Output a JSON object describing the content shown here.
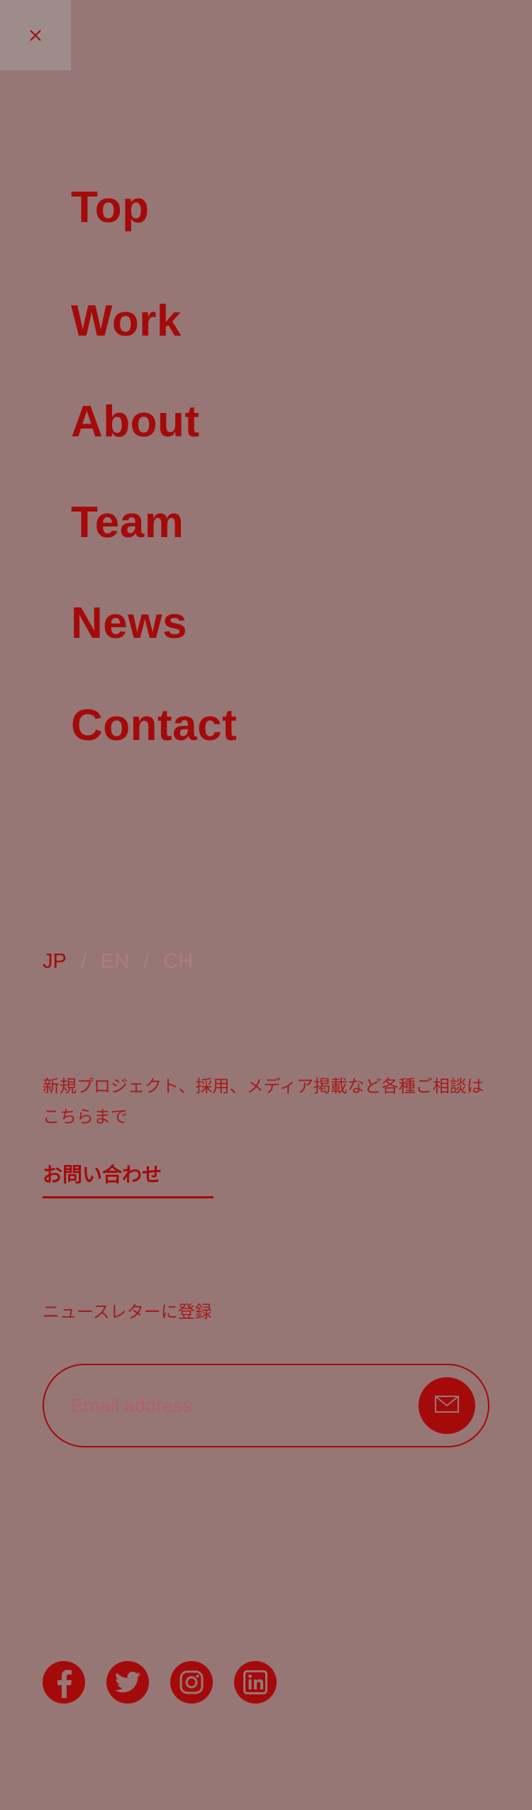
{
  "close": {
    "icon": "close-icon"
  },
  "nav": {
    "items": [
      {
        "label": "Top"
      },
      {
        "label": "Work"
      },
      {
        "label": "About"
      },
      {
        "label": "Team"
      },
      {
        "label": "News"
      },
      {
        "label": "Contact"
      }
    ]
  },
  "language": {
    "options": [
      "JP",
      "EN",
      "CH"
    ],
    "separator": "/",
    "active": "JP"
  },
  "contact": {
    "description": "新規プロジェクト、採用、メディア掲載など各種ご相談はこちらまで",
    "link_label": "お問い合わせ"
  },
  "newsletter": {
    "label": "ニュースレターに登録",
    "email_placeholder": "Email address",
    "submit_icon": "envelope-icon"
  },
  "social": {
    "items": [
      "facebook-icon",
      "twitter-icon",
      "instagram-icon",
      "linkedin-icon"
    ]
  },
  "colors": {
    "background": "#967776",
    "accent": "#a50a0a",
    "muted": "#b27b7b"
  }
}
